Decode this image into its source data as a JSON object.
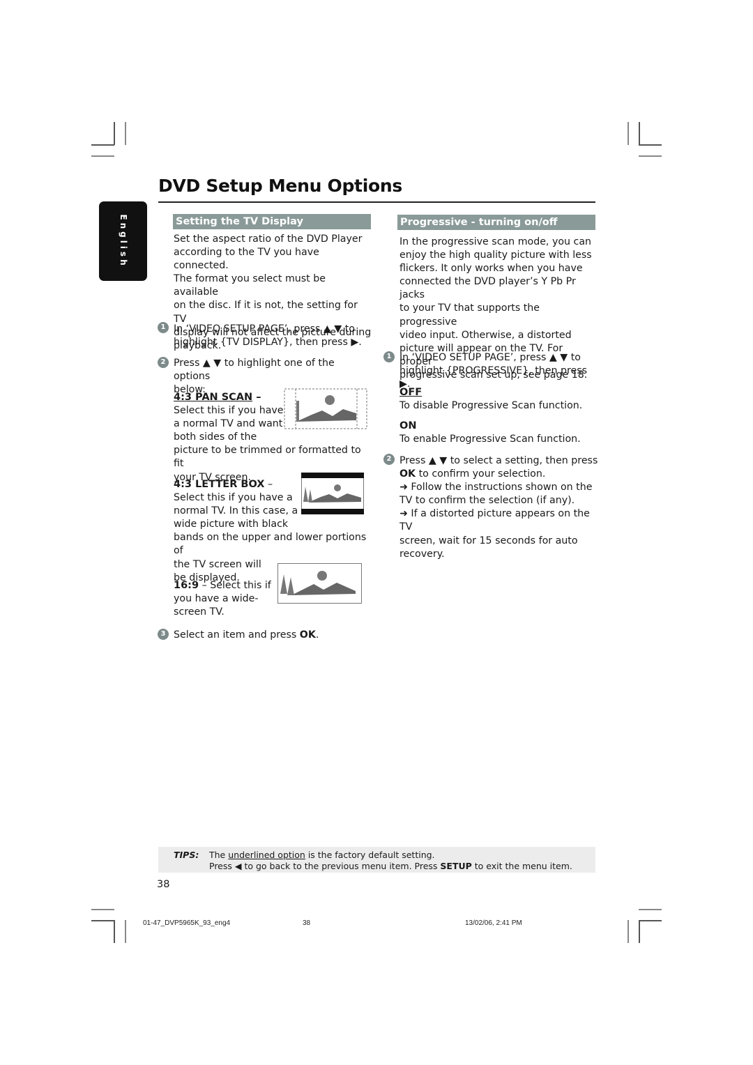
{
  "page": {
    "title": "DVD Setup Menu Options",
    "language_tab": "English",
    "page_number": "38"
  },
  "left_section": {
    "heading": "Setting the TV Display",
    "intro": [
      "Set the aspect ratio of the DVD Player",
      "according to the TV you have connected.",
      "The format you select must be available",
      "on the disc.  If it is not, the setting for TV",
      "display will not affect the picture during",
      "playback."
    ],
    "step1": {
      "num": "1",
      "line1": "In ‘VIDEO SETUP PAGE’, press ▲ ▼ to",
      "line2": "highlight {TV DISPLAY}, then press ▶."
    },
    "step2": {
      "num": "2",
      "line1": "Press ▲ ▼ to highlight one of the options",
      "line2": "below:"
    },
    "options": [
      {
        "title": "4:3 PAN SCAN",
        "dash": " –",
        "default": true,
        "lines": [
          "Select this if you have",
          "a normal TV and want",
          "both sides of the",
          "picture to be trimmed or formatted to fit",
          "your TV screen."
        ],
        "image": "pan-scan-illustration"
      },
      {
        "title": "4:3 LETTER BOX",
        "dash": " –",
        "default": false,
        "lines": [
          "Select this if you have a",
          "normal TV. In this case, a",
          "wide picture with black",
          "bands on the upper and lower portions of",
          "the TV screen will",
          "be displayed."
        ],
        "image": "letter-box-illustration"
      },
      {
        "title": "16:9",
        "dash": " – Select this if",
        "default": false,
        "lines": [
          "you have a wide-",
          "screen TV."
        ],
        "image": "widescreen-illustration"
      }
    ],
    "step3": {
      "num": "3",
      "text": "Select an item and press ",
      "bold": "OK",
      "end": "."
    }
  },
  "right_section": {
    "heading": "Progressive - turning on/off",
    "intro": [
      "In the progressive scan mode, you can",
      "enjoy the high quality picture with less",
      "flickers.  It only works when you have",
      "connected the DVD player’s Y Pb Pr jacks",
      "to your TV that supports the progressive",
      "video input.  Otherwise, a distorted",
      "picture will appear on the TV.  For proper",
      "progressive scan set up, see page 18."
    ],
    "step1": {
      "num": "1",
      "line1": "In ‘VIDEO SETUP PAGE’, press ▲ ▼ to",
      "line2": "highlight {PROGRESSIVE}, then press ▶."
    },
    "options": [
      {
        "title": "OFF",
        "default": true,
        "desc": "To disable Progressive Scan function."
      },
      {
        "title": "ON",
        "default": false,
        "desc": "To enable Progressive Scan function."
      }
    ],
    "step2": {
      "num": "2",
      "line1": "Press ▲ ▼ to select a setting, then press",
      "line2_bold": "OK",
      "line2_rest": " to confirm your selection.",
      "note1_a": "➜ Follow the instructions shown on the",
      "note1_b": "TV to confirm the selection (if any).",
      "note2_a": "➜ If a distorted picture appears on the TV",
      "note2_b": "screen, wait for 15 seconds for auto",
      "note2_c": "recovery."
    }
  },
  "tips": {
    "label": "TIPS:",
    "line1_pre": "The ",
    "line1_underlined": "underlined option",
    "line1_post": " is the factory default setting.",
    "line2_pre": "Press ◀ to go back to the previous menu item. Press ",
    "line2_bold": "SETUP",
    "line2_post": " to exit the menu item."
  },
  "print_slug": {
    "file": "01-47_DVP5965K_93_eng4",
    "page": "38",
    "timestamp": "13/02/06, 2:41 PM"
  }
}
